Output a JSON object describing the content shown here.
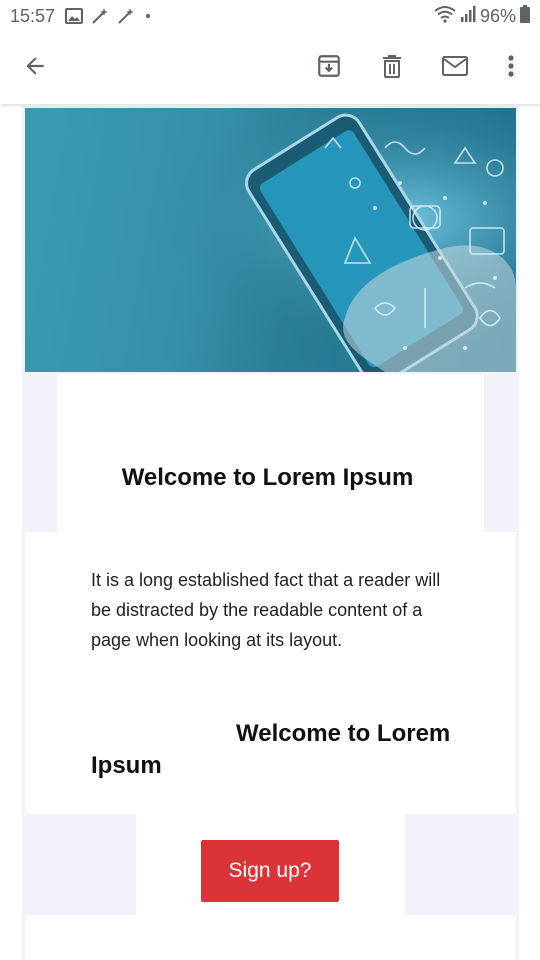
{
  "status_bar": {
    "time": "15:57",
    "battery": "96%",
    "icons": [
      "image-icon",
      "magic-wand-icon",
      "magic-wand-icon",
      "dot-icon",
      "wifi-icon",
      "signal-icon",
      "battery-icon"
    ]
  },
  "toolbar": {
    "icons": [
      "back-arrow-icon",
      "archive-icon",
      "trash-icon",
      "mail-icon",
      "more-vert-icon"
    ]
  },
  "email": {
    "heading": "Welcome to Lorem Ipsum",
    "paragraph": "It is a long established fact that a reader will be distracted by the readable content of a page when looking at its layout.",
    "heading2": "Welcome to Lorem Ipsum",
    "button_label": "Sign up?"
  },
  "colors": {
    "button": "#da3438",
    "email_background": "#f2f2fb",
    "hero": "#2b7e96"
  }
}
